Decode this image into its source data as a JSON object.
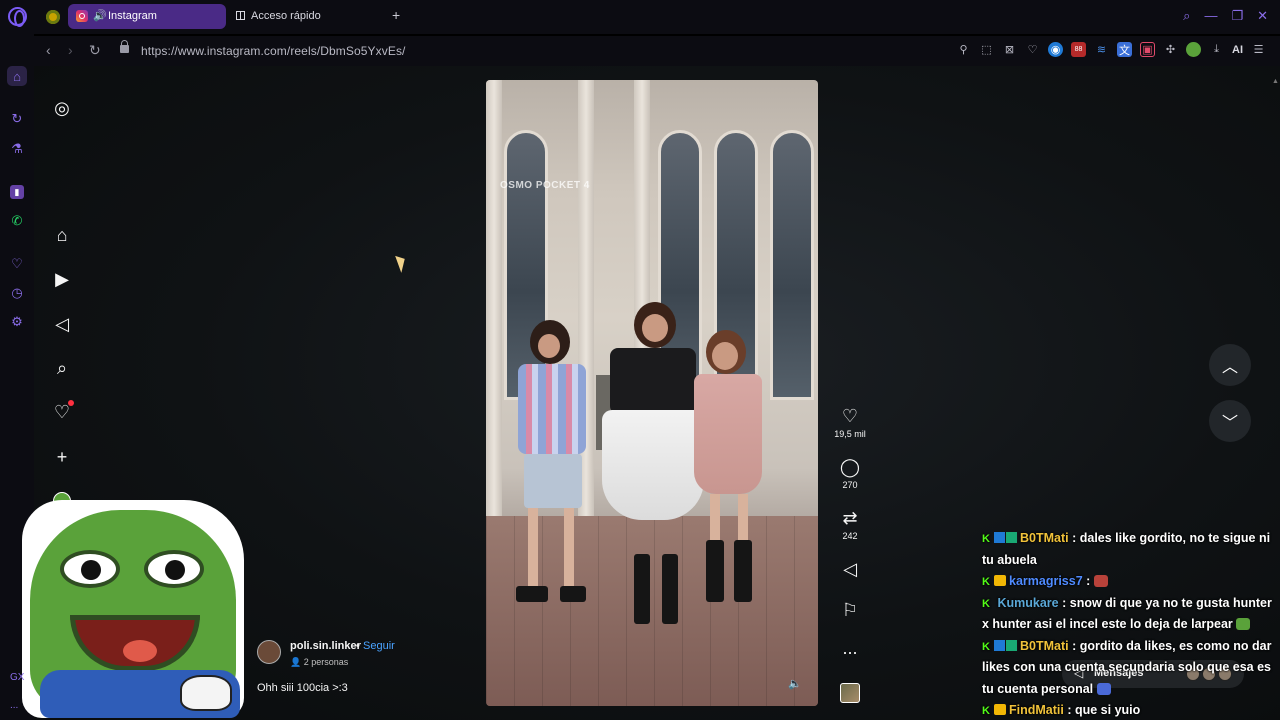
{
  "browser": {
    "active_tab_title": "Instagram",
    "second_tab_title": "Acceso rápido",
    "new_tab_label": "+",
    "url": "https://www.instagram.com/reels/DbmSo5YxvEs/",
    "ai_label": "AI",
    "extension_badge": "88"
  },
  "reel": {
    "watermark": "OSMO POCKET 4",
    "likes": "19,5 mil",
    "comments": "270",
    "reposts": "242",
    "more": "...",
    "author": "poli.sin.linker",
    "separator": "•",
    "follow": "Seguir",
    "collaborators": "2 personas",
    "caption": "Ohh siii 100cia >:3"
  },
  "messages": {
    "label": "Mensajes"
  },
  "chat": [
    {
      "badges": [
        "k",
        "b",
        "g"
      ],
      "user": "B0TMati",
      "user_color": "#f0c23a",
      "text": ": dales like gordito, no te sigue ni tu abuela"
    },
    {
      "badges": [
        "k",
        "c"
      ],
      "user": "karmagriss7",
      "user_color": "#4f8bff",
      "text": ":"
    },
    {
      "badges": [
        "k"
      ],
      "user": "Kumukare",
      "user_color": "#5aa7d6",
      "text": ": snow di que ya no te gusta hunter x hunter asi el incel este lo deja de larpear"
    },
    {
      "badges": [
        "k",
        "b",
        "g"
      ],
      "user": "B0TMati",
      "user_color": "#f0c23a",
      "text": ": gordito da likes, es como no dar likes con una cuenta secundaria solo que esa es tu cuenta personal"
    },
    {
      "badges": [
        "k",
        "c"
      ],
      "user": "FindMatii",
      "user_color": "#f0c23a",
      "text": ": que si yuio"
    }
  ],
  "sidebar": {
    "bottom_label": "GX",
    "more_label": "..."
  },
  "colors": {
    "accent": "#7b5cf5",
    "active_tab": "#4a2a86",
    "follow_link": "#4aa3ff",
    "kick_green": "#53fc18"
  }
}
